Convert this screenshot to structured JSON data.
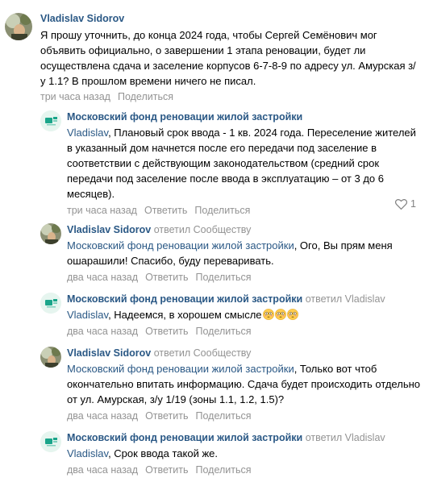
{
  "comments": [
    {
      "author": "Vladislav Sidorov",
      "text": "Я прошу уточнить, до конца 2024 года, чтобы Сергей Семёнович мог объявить официально, о завершении 1 этапа реновации, будет ли осуществлена сдача и заселение корпусов 6-7-8-9 по адресу ул. Амурская з/у 1.1? В прошлом времени ничего не писал.",
      "time": "три часа назад",
      "share": "Поделиться"
    },
    {
      "author": "Московский фонд реновации жилой застройки",
      "mention": "Vladislav",
      "text": ", Плановый срок ввода - 1 кв. 2024 года. Переселение жителей в указанный дом начнется после его передачи под заселение в соответствии с действующим законодательством (средний срок передачи под заселение после ввода в эксплуатацию – от 3 до 6 месяцев).",
      "time": "три часа назад",
      "reply": "Ответить",
      "share": "Поделиться",
      "likes": "1"
    },
    {
      "author": "Vladislav Sidorov",
      "replied_label": "ответил",
      "replied_to": "Сообществу",
      "mention": "Московский фонд реновации жилой застройки",
      "text": ", Ого, Вы прям меня ошарашили! Спасибо, буду переваривать.",
      "time": "два часа назад",
      "reply": "Ответить",
      "share": "Поделиться"
    },
    {
      "author": "Московский фонд реновации жилой застройки",
      "replied_label": "ответил",
      "replied_to": "Vladislav",
      "mention": "Vladislav",
      "text": ", Надеемся, в хорошем смысле",
      "emoji": "flushed-face-icon",
      "time": "два часа назад",
      "reply": "Ответить",
      "share": "Поделиться"
    },
    {
      "author": "Vladislav Sidorov",
      "replied_label": "ответил",
      "replied_to": "Сообществу",
      "mention": "Московский фонд реновации жилой застройки",
      "text": ", Только вот чтоб окончательно впитать информацию. Сдача будет происходить отдельно от ул. Амурская, з/у 1/19 (зоны 1.1, 1.2, 1.5)?",
      "time": "два часа назад",
      "reply": "Ответить",
      "share": "Поделиться"
    },
    {
      "author": "Московский фонд реновации жилой застройки",
      "replied_label": "ответил",
      "replied_to": "Vladislav",
      "mention": "Vladislav",
      "text": ", Срок ввода такой же.",
      "time": "два часа назад",
      "reply": "Ответить",
      "share": "Поделиться"
    }
  ],
  "colors": {
    "link": "#2a5885",
    "muted": "#939393",
    "fund_avatar_bg": "#e6f5ef",
    "fund_logo": "#1aa58a"
  }
}
